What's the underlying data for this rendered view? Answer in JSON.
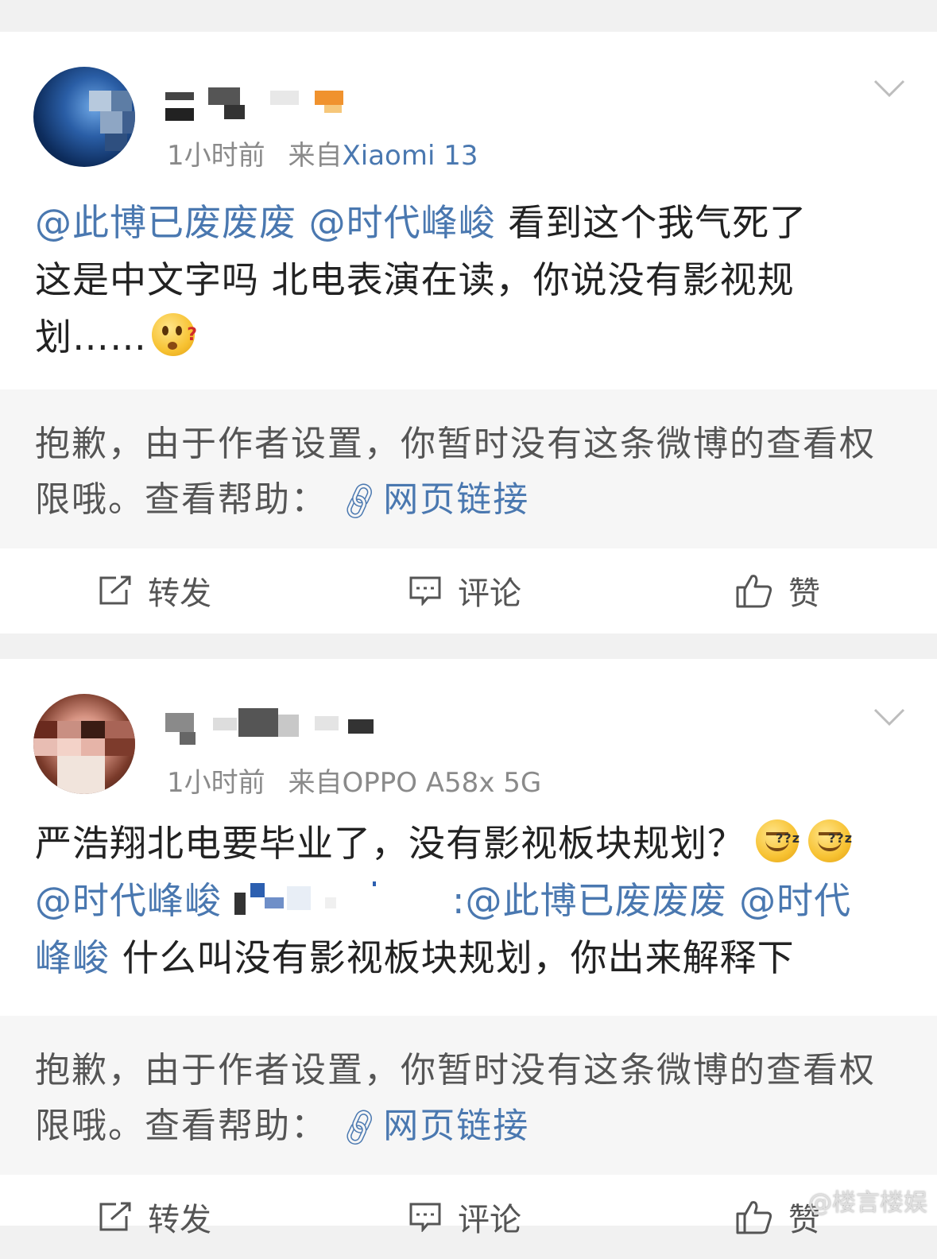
{
  "posts": [
    {
      "time": "1小时前",
      "source_prefix": "来自",
      "device": "Xiaomi 13",
      "mentions": [
        "@此博已废废废",
        "@时代峰峻"
      ],
      "line1_rest": " 看到这个我气死了",
      "line2": "这是中文字吗 北电表演在读，你说没有影视规",
      "line3": "划……",
      "emoji_name": "question-face-emoji",
      "notice_text": "抱歉，由于作者设置，你暂时没有这条微博的查看权限哦。查看帮助：",
      "notice_link": "网页链接",
      "actions": {
        "repost": "转发",
        "comment": "评论",
        "like": "赞"
      }
    },
    {
      "time": "1小时前",
      "source_prefix": "来自",
      "device": "OPPO A58x 5G",
      "line1": "严浩翔北电要毕业了，没有影视板块规划？",
      "emoji_name": "sleepy-face-emoji",
      "mention_a": "@时代峰峻",
      "mention_b": ":@此博已废废废",
      "mention_c": " @时代",
      "mention_d": "峰峻",
      "line3_rest": " 什么叫没有影视板块规划，你出来解释下",
      "notice_text": "抱歉，由于作者设置，你暂时没有这条微博的查看权限哦。查看帮助：",
      "notice_link": "网页链接",
      "actions": {
        "repost": "转发",
        "comment": "评论",
        "like": "赞"
      }
    }
  ],
  "watermark": "@楼言楼娱"
}
